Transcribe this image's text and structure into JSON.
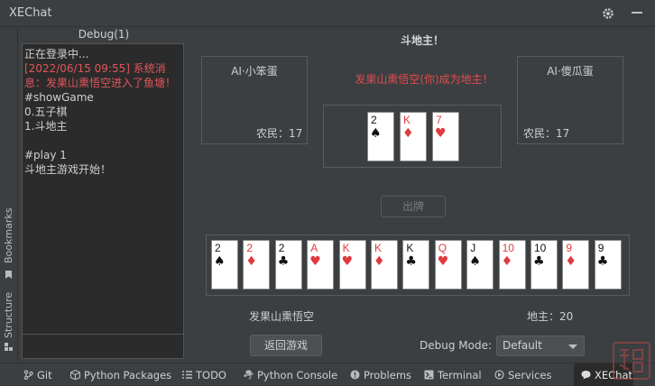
{
  "window": {
    "title": "XEChat"
  },
  "side_tabs": {
    "bookmarks": "Bookmarks",
    "structure": "Structure"
  },
  "debug": {
    "title": "Debug(1)",
    "log": [
      {
        "text": "正在登录中...",
        "color": "normal"
      },
      {
        "text": "[2022/06/15 09:55] 系统消息：发果山熏悟空进入了鱼塘！",
        "color": "red"
      },
      {
        "text": "#showGame",
        "color": "normal"
      },
      {
        "text": "0.五子棋",
        "color": "normal"
      },
      {
        "text": "1.斗地主",
        "color": "normal"
      },
      {
        "text": " ",
        "color": "normal"
      },
      {
        "text": "#play 1",
        "color": "normal"
      },
      {
        "text": "斗地主游戏开始！",
        "color": "normal"
      }
    ]
  },
  "game": {
    "title": "斗地主！",
    "left_player": {
      "name": "AI·小笨蛋",
      "role": "农民：17"
    },
    "right_player": {
      "name": "AI·傻瓜蛋",
      "role": "农民：17"
    },
    "announcement": "发果山熏悟空(你)成为地主！",
    "landlord_cards": [
      {
        "rank": "2",
        "suit": "♠",
        "color": "black"
      },
      {
        "rank": "K",
        "suit": "♦",
        "color": "red"
      },
      {
        "rank": "7",
        "suit": "♥",
        "color": "red"
      }
    ],
    "play_button": "出牌",
    "hand": [
      {
        "rank": "2",
        "suit": "♠",
        "color": "black"
      },
      {
        "rank": "2",
        "suit": "♦",
        "color": "red"
      },
      {
        "rank": "2",
        "suit": "♣",
        "color": "black"
      },
      {
        "rank": "A",
        "suit": "♥",
        "color": "red"
      },
      {
        "rank": "K",
        "suit": "♥",
        "color": "red"
      },
      {
        "rank": "K",
        "suit": "♦",
        "color": "red"
      },
      {
        "rank": "K",
        "suit": "♣",
        "color": "black"
      },
      {
        "rank": "Q",
        "suit": "♥",
        "color": "red"
      },
      {
        "rank": "J",
        "suit": "♠",
        "color": "black"
      },
      {
        "rank": "10",
        "suit": "♦",
        "color": "red"
      },
      {
        "rank": "10",
        "suit": "♣",
        "color": "black"
      },
      {
        "rank": "9",
        "suit": "♦",
        "color": "red"
      },
      {
        "rank": "9",
        "suit": "♣",
        "color": "black"
      }
    ],
    "player_name": "发果山熏悟空",
    "landlord_count": "地主：20",
    "restart_button": "返回游戏",
    "debug_mode_label": "Debug Mode:",
    "debug_mode_value": "Default"
  },
  "bottom_tabs": [
    {
      "label": "Git",
      "icon": "git-branch-icon"
    },
    {
      "label": "Python Packages",
      "icon": "packages-icon"
    },
    {
      "label": "TODO",
      "icon": "list-icon"
    },
    {
      "label": "Python Console",
      "icon": "python-icon"
    },
    {
      "label": "Problems",
      "icon": "alert-icon"
    },
    {
      "label": "Terminal",
      "icon": "terminal-icon"
    },
    {
      "label": "Services",
      "icon": "services-icon"
    },
    {
      "label": "XEChat",
      "icon": "chat-icon",
      "active": true
    }
  ],
  "colors": {
    "red_text": "#e04a4f",
    "card_red": "#e03a3e",
    "bg": "#3c3f41",
    "panel": "#2b2b2b"
  }
}
